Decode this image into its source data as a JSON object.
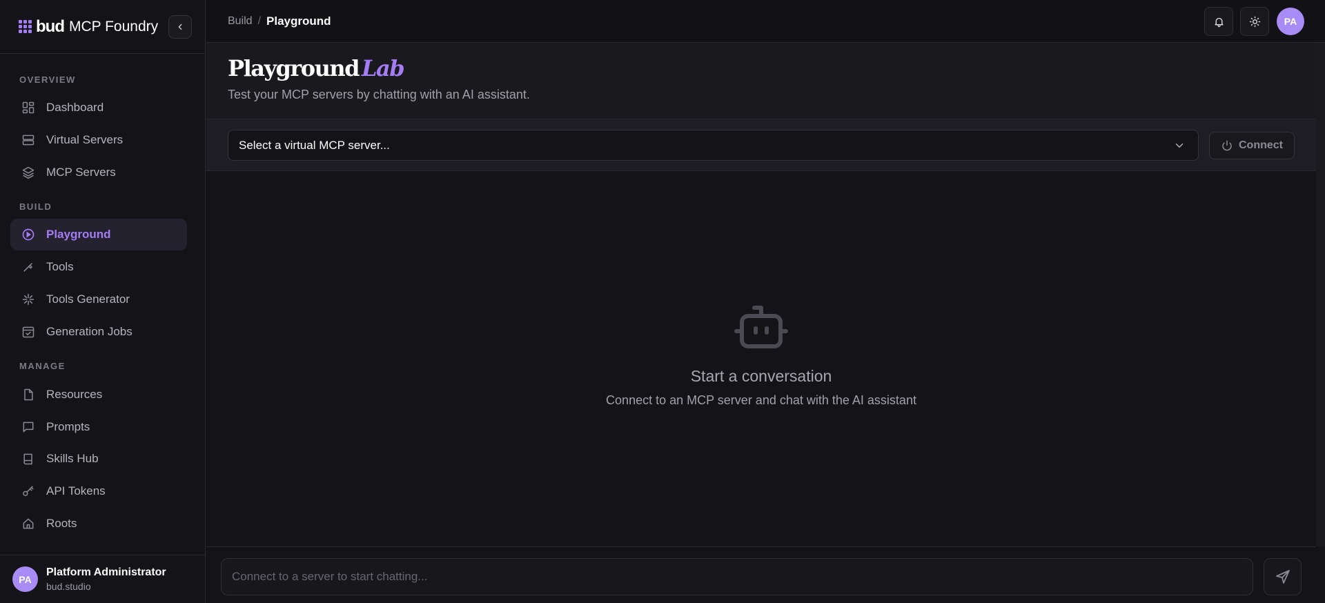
{
  "brand": {
    "logo_text": "bud",
    "name": "MCP Foundry"
  },
  "sidebar": {
    "sections": [
      {
        "title": "OVERVIEW",
        "items": [
          {
            "label": "Dashboard",
            "icon": "dashboard-icon"
          },
          {
            "label": "Virtual Servers",
            "icon": "server-icon"
          },
          {
            "label": "MCP Servers",
            "icon": "layers-icon"
          }
        ]
      },
      {
        "title": "BUILD",
        "items": [
          {
            "label": "Playground",
            "icon": "play-circle-icon",
            "active": true
          },
          {
            "label": "Tools",
            "icon": "wrench-icon"
          },
          {
            "label": "Tools Generator",
            "icon": "sparkle-icon"
          },
          {
            "label": "Generation Jobs",
            "icon": "calendar-check-icon"
          }
        ]
      },
      {
        "title": "MANAGE",
        "items": [
          {
            "label": "Resources",
            "icon": "file-icon"
          },
          {
            "label": "Prompts",
            "icon": "message-square-icon"
          },
          {
            "label": "Skills Hub",
            "icon": "book-icon"
          },
          {
            "label": "API Tokens",
            "icon": "key-icon"
          },
          {
            "label": "Roots",
            "icon": "home-icon"
          }
        ]
      }
    ]
  },
  "user": {
    "initials": "PA",
    "name": "Platform Administrator",
    "org": "bud.studio"
  },
  "breadcrumb": {
    "root": "Build",
    "separator": "/",
    "current": "Playground"
  },
  "header": {
    "title": "Playground",
    "title_accent": "Lab",
    "subtitle": "Test your MCP servers by chatting with an AI assistant."
  },
  "server_select": {
    "placeholder": "Select a virtual MCP server...",
    "connect_label": "Connect"
  },
  "empty_state": {
    "title": "Start a conversation",
    "subtitle": "Connect to an MCP server and chat with the AI assistant"
  },
  "composer": {
    "placeholder": "Connect to a server to start chatting..."
  },
  "colors": {
    "accent": "#a47cf3",
    "background": "#141418",
    "avatar": "#a98bf5"
  }
}
